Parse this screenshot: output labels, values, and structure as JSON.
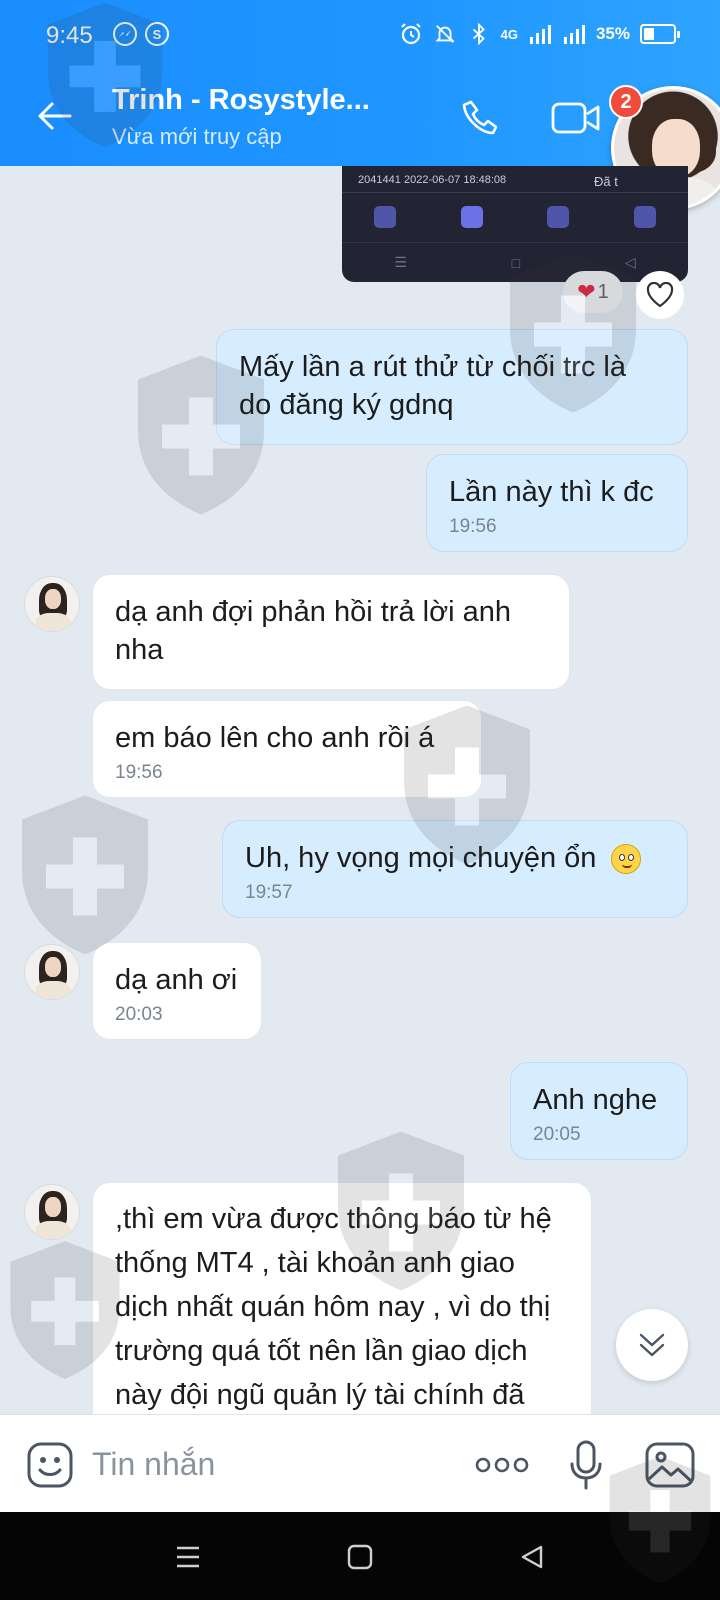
{
  "status_bar": {
    "time": "9:45",
    "network": "4G",
    "battery_text": "35%",
    "battery_level": 0.35
  },
  "header": {
    "contact_name": "Trinh - Rosystyle...",
    "status": "Vừa mới truy cập",
    "unread_badge": "2",
    "accent_color": "#1e96ff"
  },
  "shared_image": {
    "order_id": "2041441",
    "datetime": "2022-06-07 18:48:08",
    "status_fragment": "Đã t"
  },
  "reaction": {
    "heart_count": "1"
  },
  "messages": [
    {
      "side": "out",
      "text": "Mấy lần a rút thử từ chối trc là do đăng ký gdnq",
      "time": ""
    },
    {
      "side": "out",
      "text": "Lần này thì k đc",
      "time": "19:56"
    },
    {
      "side": "in",
      "text": "dạ anh đợi phản hồi trả lời anh nha",
      "time": ""
    },
    {
      "side": "in",
      "text": "em báo lên cho anh rồi á",
      "time": "19:56"
    },
    {
      "side": "out",
      "text": "Uh, hy vọng mọi chuyện ổn",
      "time": "19:57"
    },
    {
      "side": "in",
      "text": "dạ anh ơi",
      "time": "20:03"
    },
    {
      "side": "out",
      "text": "Anh nghe",
      "time": "20:05"
    },
    {
      "side": "in",
      "text": ",thì em vừa được thông báo từ hệ thống MT4 , tài khoản anh giao dịch nhất quán hôm nay , vì do thị trường quá tốt nên lần giao dịch này đội ngũ quản lý tài chính đã kiếm được lợi nhuận",
      "time": ""
    }
  ],
  "input": {
    "placeholder": "Tin nhắn"
  }
}
